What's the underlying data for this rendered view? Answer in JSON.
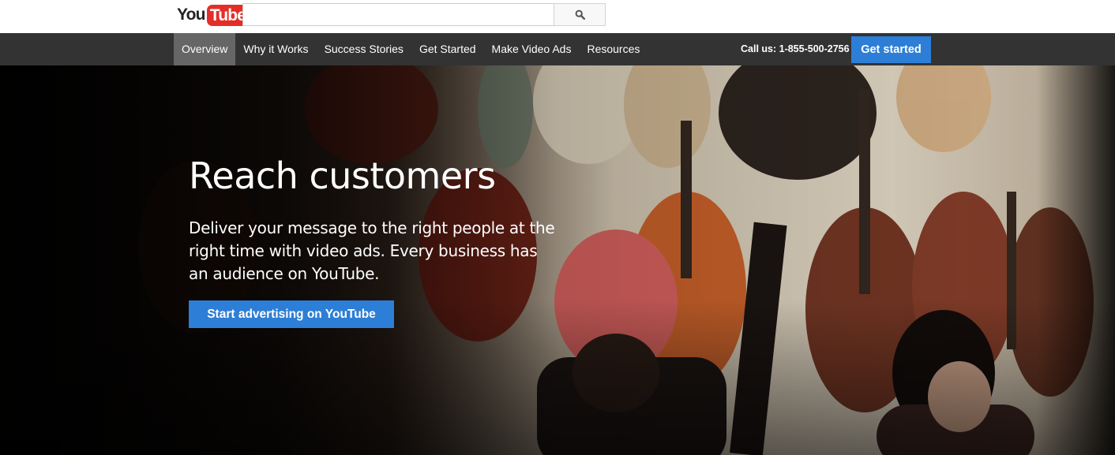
{
  "brand": {
    "logo_you": "You",
    "logo_tube": "Tube",
    "red": "#e52d27"
  },
  "search": {
    "placeholder": "",
    "button_icon": "search-icon"
  },
  "nav": {
    "items": [
      {
        "label": "Overview",
        "active": true
      },
      {
        "label": "Why it Works",
        "active": false
      },
      {
        "label": "Success Stories",
        "active": false
      },
      {
        "label": "Get Started",
        "active": false
      },
      {
        "label": "Make Video Ads",
        "active": false
      },
      {
        "label": "Resources",
        "active": false
      }
    ],
    "call_us": "Call us: 1-855-500-2756",
    "cta_label": "Get started"
  },
  "hero": {
    "title": "Reach customers",
    "description": "Deliver your message to the right people at the right time with video ads. Every business has an audience on YouTube.",
    "cta_label": "Start advertising on YouTube"
  },
  "colors": {
    "accent": "#2d7ed6",
    "nav_bg": "#333333",
    "nav_active": "#666666"
  }
}
